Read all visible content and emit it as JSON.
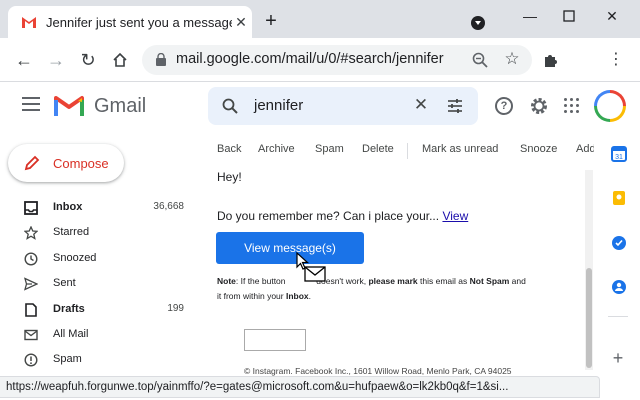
{
  "browser": {
    "tab_title": "Jennifer just sent you a message",
    "url": "mail.google.com/mail/u/0/#search/jennifer",
    "status_url": "https://weapfuh.forgunwe.top/yainmffo/?e=gates@microsoft.com&u=hufpaew&o=lk2kb0q&f=1&si..."
  },
  "gmail": {
    "wordmark": "Gmail",
    "search_query": "jennifer",
    "compose_label": "Compose",
    "nav": [
      {
        "label": "Inbox",
        "count": "36,668",
        "icon": "inbox-icon",
        "bold": true
      },
      {
        "label": "Starred",
        "count": "",
        "icon": "star-icon",
        "bold": false
      },
      {
        "label": "Snoozed",
        "count": "",
        "icon": "clock-icon",
        "bold": false
      },
      {
        "label": "Sent",
        "count": "",
        "icon": "send-icon",
        "bold": false
      },
      {
        "label": "Drafts",
        "count": "199",
        "icon": "draft-icon",
        "bold": true
      },
      {
        "label": "All Mail",
        "count": "",
        "icon": "mail-icon",
        "bold": false
      },
      {
        "label": "Spam",
        "count": "",
        "icon": "spam-icon",
        "bold": false
      }
    ],
    "actions": [
      "Back",
      "Archive",
      "Spam",
      "Delete",
      "Mark as unread",
      "Snooze",
      "Add"
    ]
  },
  "message": {
    "greeting": "Hey!",
    "question": "Do you remember me? Can i place your...",
    "view_link": "View",
    "button_label": "View message(s)",
    "note_label": "Note",
    "note_part1": ": If the button",
    "note_part2": "doesn't work,",
    "note_please_mark": "please mark",
    "note_part3": "this email as",
    "note_not_spam": "Not Spam",
    "note_part4": "and",
    "note_part5": "it from within your",
    "note_inbox": "Inbox",
    "note_end": ".",
    "footer": "© Instagram. Facebook Inc., 1601 Willow Road, Menlo Park, CA 94025"
  },
  "colors": {
    "accent": "#1a73e8",
    "compose_red": "#d93025",
    "link": "#1a0dab"
  }
}
